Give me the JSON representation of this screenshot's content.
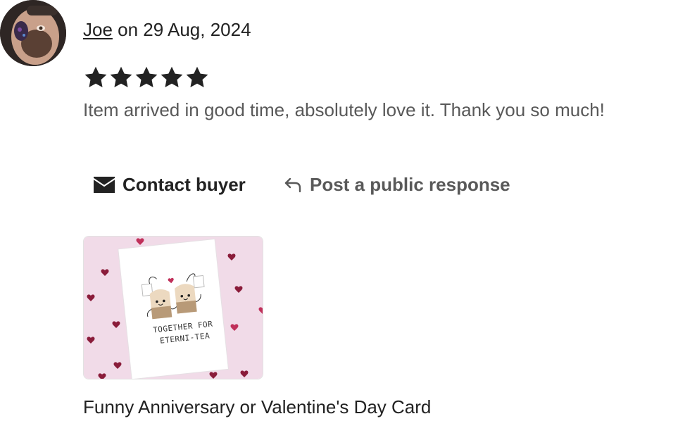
{
  "review": {
    "author": "Joe",
    "date_text": " on 29 Aug, 2024",
    "rating": 5,
    "rating_max": 5,
    "text": "Item arrived in good time, absolutely love it. Thank you so much!"
  },
  "actions": {
    "contact_label": "Contact buyer",
    "contact_icon": "envelope-icon",
    "respond_label": "Post a public response",
    "respond_icon": "reply-arrow-icon"
  },
  "product": {
    "title": "Funny Anniversary or Valentine's Day Card",
    "card_text_line1": "TOGETHER FOR",
    "card_text_line2": "ETERNI-TEA"
  },
  "colors": {
    "text": "#222222",
    "muted": "#595959",
    "star": "#222222",
    "thumb_background": "#f1dbe8"
  }
}
